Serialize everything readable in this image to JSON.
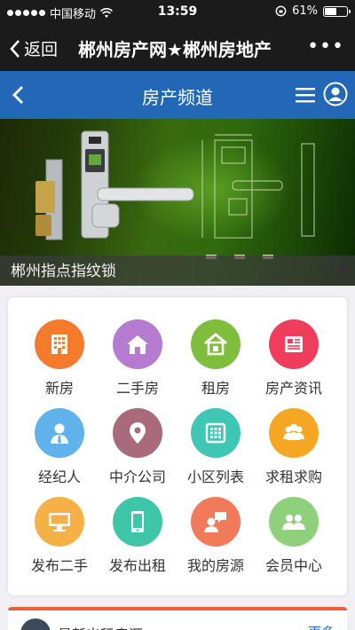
{
  "status_bar": {
    "carrier": "中国移动",
    "time": "13:59",
    "battery": "61%",
    "battery_level": 0.61
  },
  "wechat_bar": {
    "back_label": "返回",
    "title": "郴州房产网★郴州房地产",
    "more": "•••"
  },
  "site_header": {
    "title": "房产频道"
  },
  "banner": {
    "caption": "郴州指点指纹锁"
  },
  "grid": {
    "items": [
      {
        "label": "新房",
        "icon": "building-icon",
        "color": "#f37b2b"
      },
      {
        "label": "二手房",
        "icon": "home-icon",
        "color": "#b57bd0"
      },
      {
        "label": "租房",
        "icon": "house-icon",
        "color": "#7fbd3c"
      },
      {
        "label": "房产资讯",
        "icon": "news-icon",
        "color": "#ef3d5b"
      },
      {
        "label": "经纪人",
        "icon": "agent-icon",
        "color": "#5fb2ea"
      },
      {
        "label": "中介公司",
        "icon": "location-pin-icon",
        "color": "#a96a7c"
      },
      {
        "label": "小区列表",
        "icon": "grid-building-icon",
        "color": "#3fc6b4"
      },
      {
        "label": "求租求购",
        "icon": "group-icon",
        "color": "#f5a623"
      },
      {
        "label": "发布二手",
        "icon": "monitor-icon",
        "color": "#f5b146"
      },
      {
        "label": "发布出租",
        "icon": "phone-icon",
        "color": "#3fc6a8"
      },
      {
        "label": "我的房源",
        "icon": "chat-user-icon",
        "color": "#f07a5a"
      },
      {
        "label": "会员中心",
        "icon": "members-icon",
        "color": "#8fd07a"
      }
    ]
  },
  "bottom_section": {
    "title": "最新出租房源",
    "more": "更多"
  }
}
